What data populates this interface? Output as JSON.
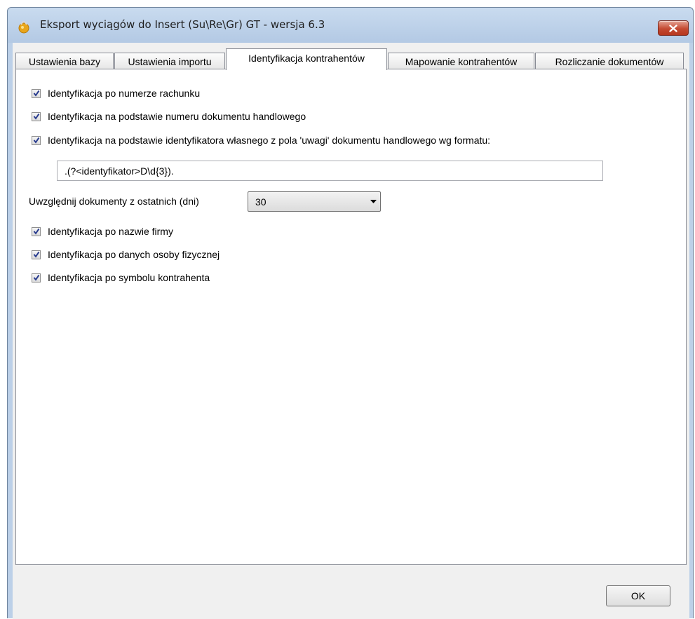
{
  "window": {
    "title": "Eksport wyciągów do Insert (Su\\Re\\Gr) GT - wersja 6.3",
    "icon": "padlock-app-icon",
    "close_icon": "close-x-icon",
    "accent_close": "#c44a32"
  },
  "tabs": [
    {
      "label": "Ustawienia bazy",
      "active": false
    },
    {
      "label": "Ustawienia importu",
      "active": false
    },
    {
      "label": "Identyfikacja kontrahentów",
      "active": true
    },
    {
      "label": "Mapowanie kontrahentów",
      "active": false
    },
    {
      "label": "Rozliczanie dokumentów",
      "active": false
    }
  ],
  "panel": {
    "checks_top": [
      {
        "label": "Identyfikacja po numerze rachunku",
        "checked": true
      },
      {
        "label": "Identyfikacja na podstawie numeru dokumentu handlowego",
        "checked": true
      },
      {
        "label": "Identyfikacja na podstawie identyfikatora własnego z pola 'uwagi' dokumentu handlowego wg formatu:",
        "checked": true
      }
    ],
    "format_value": ".(?<identyfikator>D\\d{3}).",
    "days_label": "Uwzględnij dokumenty z ostatnich (dni)",
    "days_value": "30",
    "checks_bottom": [
      {
        "label": "Identyfikacja po nazwie firmy",
        "checked": true
      },
      {
        "label": "Identyfikacja po danych osoby fizycznej",
        "checked": true
      },
      {
        "label": "Identyfikacja po symbolu kontrahenta",
        "checked": true
      }
    ]
  },
  "footer": {
    "ok_label": "OK"
  }
}
